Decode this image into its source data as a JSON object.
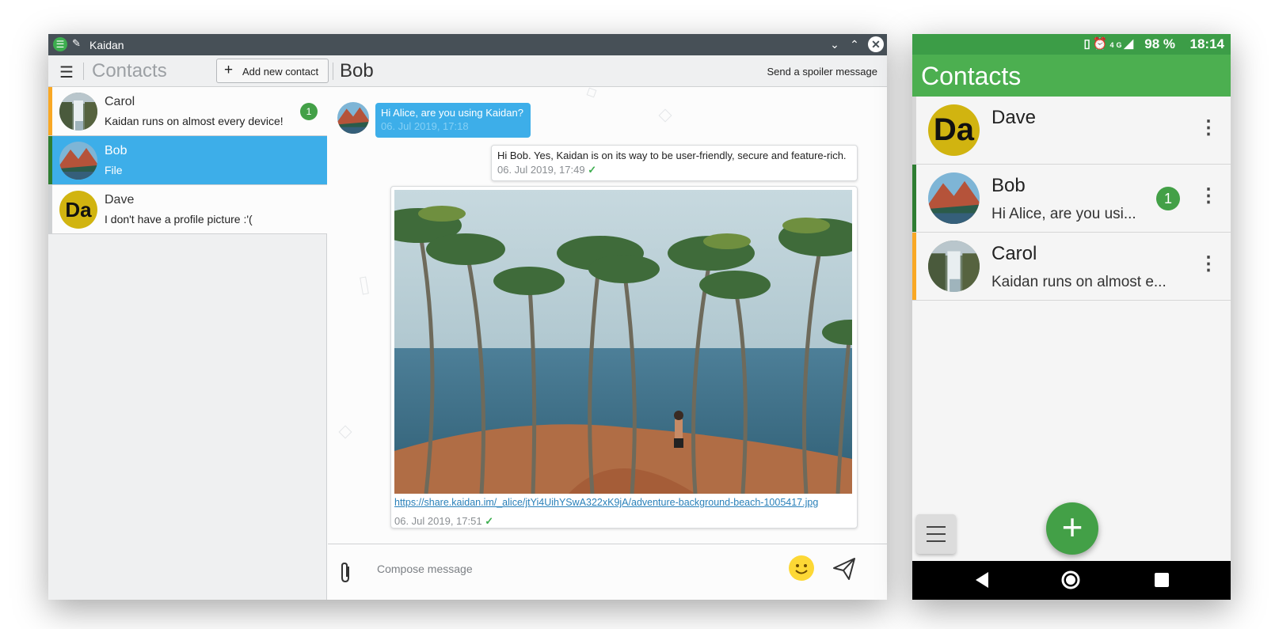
{
  "desktop": {
    "window_title": "Kaidan",
    "toolbar": {
      "menu_icon": "hamburger-icon",
      "contacts_title": "Contacts",
      "add_contact_label": "Add new contact",
      "chat_title": "Bob",
      "spoiler_label": "Send a spoiler message"
    },
    "contacts": [
      {
        "name": "Carol",
        "last_message": "Kaidan runs on almost every device!",
        "unread": "1",
        "accent": "#f9a825",
        "avatar": "waterfall"
      },
      {
        "name": "Bob",
        "last_message": "File",
        "unread": "",
        "accent": "#2e7d32",
        "avatar": "mountain-lake",
        "selected": true
      },
      {
        "name": "Dave",
        "last_message": "I don't have a profile picture :'(",
        "unread": "",
        "accent": "#cfd1d3",
        "avatar_initials": "Da"
      }
    ],
    "messages": [
      {
        "direction": "incoming",
        "text": "Hi Alice, are you using Kaidan?",
        "time": "06. Jul 2019, 17:18"
      },
      {
        "direction": "outgoing",
        "text": "Hi Bob. Yes, Kaidan is on its way to be user-friendly, secure and feature-rich.",
        "time": "06. Jul 2019, 17:49",
        "delivered": "✓"
      },
      {
        "direction": "outgoing",
        "type": "image",
        "link": "https://share.kaidan.im/_alice/jtYi4UihYSwA322xK9jA/adventure-background-beach-1005417.jpg",
        "time": "06. Jul 2019, 17:51",
        "delivered": "✓"
      }
    ],
    "composer": {
      "placeholder": "Compose message",
      "attach_icon": "paperclip-icon",
      "emoji_icon": "emoji-icon",
      "send_icon": "send-icon"
    }
  },
  "mobile": {
    "status_bar": {
      "battery": "98 %",
      "time": "18:14",
      "network": "4G"
    },
    "title": "Contacts",
    "contacts": [
      {
        "name": "Dave",
        "last_message": "",
        "unread": "",
        "accent": "#d6d6d6",
        "avatar_initials": "Da"
      },
      {
        "name": "Bob",
        "last_message": "Hi Alice, are you usi...",
        "unread": "1",
        "accent": "#2e7d32",
        "avatar": "mountain-lake"
      },
      {
        "name": "Carol",
        "last_message": "Kaidan runs on almost e...",
        "unread": "",
        "accent": "#f9a825",
        "avatar": "waterfall"
      }
    ],
    "fab_icon": "plus-icon"
  },
  "colors": {
    "accent_blue": "#3daee9",
    "brand_green": "#4caf50",
    "titlebar": "#475057"
  }
}
